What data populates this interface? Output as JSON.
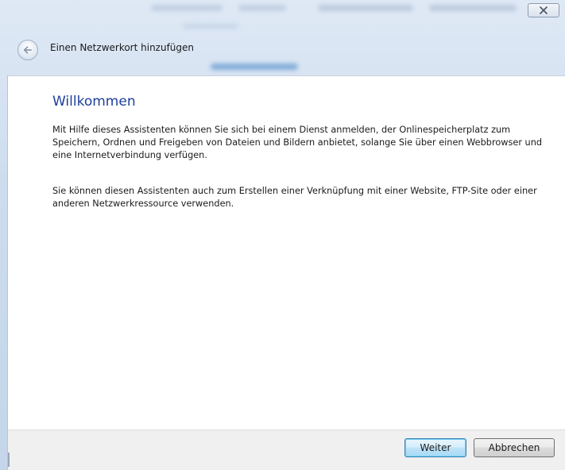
{
  "window": {
    "close_icon": "close-icon"
  },
  "header": {
    "back_icon": "back-arrow-icon",
    "title": "Einen Netzwerkort hinzufügen"
  },
  "content": {
    "heading": "Willkommen",
    "paragraph1": "Mit Hilfe dieses Assistenten können Sie sich bei einem Dienst anmelden, der Onlinespeicherplatz zum Speichern, Ordnen und Freigeben von Dateien und Bildern anbietet, solange Sie über einen Webbrowser und eine Internetverbindung verfügen.",
    "paragraph2": "Sie können diesen Assistenten auch zum Erstellen einer Verknüpfung mit einer Website, FTP-Site oder einer anderen Netzwerkressource verwenden."
  },
  "footer": {
    "next_label": "Weiter",
    "cancel_label": "Abbrechen"
  },
  "colors": {
    "heading": "#1e3f9c",
    "accent_button_border": "#3c7fb1"
  }
}
